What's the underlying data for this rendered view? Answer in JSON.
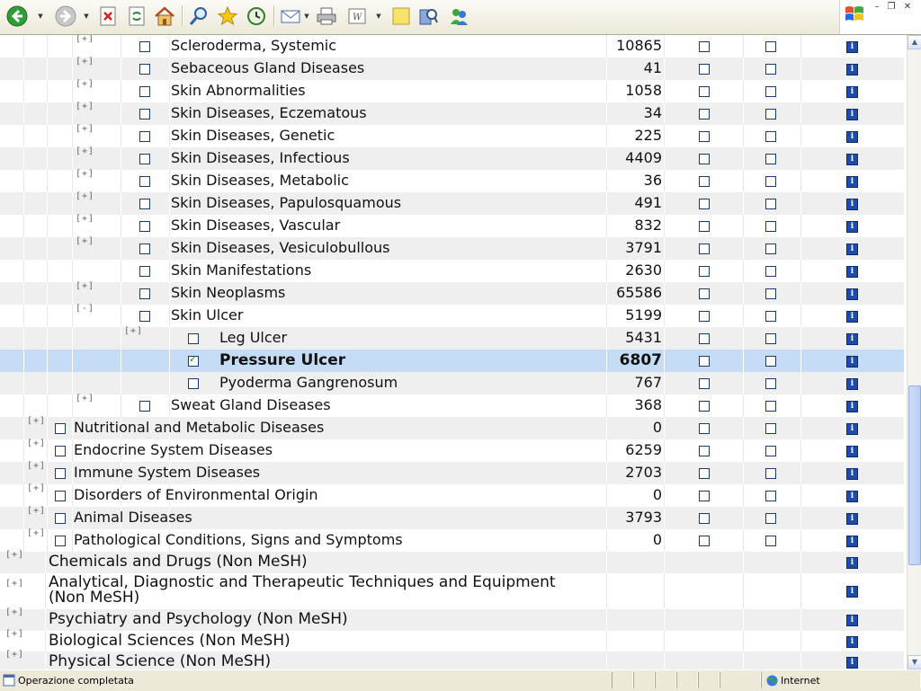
{
  "toolbar": {
    "buttons": [
      {
        "name": "back-button",
        "icon": "back-arrow-icon"
      },
      {
        "name": "forward-button",
        "icon": "forward-arrow-icon"
      },
      {
        "name": "stop-button",
        "icon": "stop-icon"
      },
      {
        "name": "refresh-button",
        "icon": "refresh-icon"
      },
      {
        "name": "home-button",
        "icon": "home-icon"
      },
      {
        "name": "search-button",
        "icon": "search-icon"
      },
      {
        "name": "favorites-button",
        "icon": "star-icon"
      },
      {
        "name": "history-button",
        "icon": "history-icon"
      },
      {
        "name": "mail-button",
        "icon": "mail-icon"
      },
      {
        "name": "print-button",
        "icon": "printer-icon"
      },
      {
        "name": "edit-button",
        "icon": "word-icon"
      },
      {
        "name": "discuss-button",
        "icon": "note-icon"
      },
      {
        "name": "research-button",
        "icon": "research-icon"
      },
      {
        "name": "messenger-button",
        "icon": "messenger-icon"
      }
    ],
    "window_controls": {
      "minimize": "–",
      "restore": "❐",
      "close": "✕"
    }
  },
  "tree": {
    "rows": [
      {
        "expander": "[+]",
        "label": "Scleroderma, Systemic",
        "count": "10865",
        "checked": false
      },
      {
        "expander": "[+]",
        "label": "Sebaceous Gland Diseases",
        "count": "41",
        "checked": false
      },
      {
        "expander": "[+]",
        "label": "Skin Abnormalities",
        "count": "1058",
        "checked": false
      },
      {
        "expander": "[+]",
        "label": "Skin Diseases, Eczematous",
        "count": "34",
        "checked": false
      },
      {
        "expander": "[+]",
        "label": "Skin Diseases, Genetic",
        "count": "225",
        "checked": false
      },
      {
        "expander": "[+]",
        "label": "Skin Diseases, Infectious",
        "count": "4409",
        "checked": false
      },
      {
        "expander": "[+]",
        "label": "Skin Diseases, Metabolic",
        "count": "36",
        "checked": false
      },
      {
        "expander": "[+]",
        "label": "Skin Diseases, Papulosquamous",
        "count": "491",
        "checked": false
      },
      {
        "expander": "[+]",
        "label": "Skin Diseases, Vascular",
        "count": "832",
        "checked": false
      },
      {
        "expander": "[+]",
        "label": "Skin Diseases, Vesiculobullous",
        "count": "3791",
        "checked": false
      },
      {
        "expander": "",
        "label": "Skin Manifestations",
        "count": "2630",
        "checked": false
      },
      {
        "expander": "[+]",
        "label": "Skin Neoplasms",
        "count": "65586",
        "checked": false
      },
      {
        "expander": "[-]",
        "label": "Skin Ulcer",
        "count": "5199",
        "checked": false
      },
      {
        "expander": "[+]",
        "label": "Leg Ulcer",
        "count": "5431",
        "checked": false
      },
      {
        "expander": "",
        "label": "Pressure Ulcer",
        "count": "6807",
        "checked": true
      },
      {
        "expander": "",
        "label": "Pyoderma Gangrenosum",
        "count": "767",
        "checked": false
      },
      {
        "expander": "[+]",
        "label": "Sweat Gland Diseases",
        "count": "368",
        "checked": false
      },
      {
        "expander": "[+]",
        "label": "Nutritional and Metabolic Diseases",
        "count": "0",
        "checked": false
      },
      {
        "expander": "[+]",
        "label": "Endocrine System Diseases",
        "count": "6259",
        "checked": false
      },
      {
        "expander": "[+]",
        "label": "Immune System Diseases",
        "count": "2703",
        "checked": false
      },
      {
        "expander": "[+]",
        "label": "Disorders of Environmental Origin",
        "count": "0",
        "checked": false
      },
      {
        "expander": "[+]",
        "label": "Animal Diseases",
        "count": "3793",
        "checked": false
      },
      {
        "expander": "[+]",
        "label": "Pathological Conditions, Signs and Symptoms",
        "count": "0",
        "checked": false
      },
      {
        "expander": "[+]",
        "label": "Chemicals and Drugs (Non MeSH)"
      },
      {
        "expander": "[+]",
        "label": "Analytical, Diagnostic and Therapeutic Techniques and Equipment",
        "label2": "(Non MeSH)"
      },
      {
        "expander": "[+]",
        "label": "Psychiatry and Psychology (Non MeSH)"
      },
      {
        "expander": "[+]",
        "label": "Biological Sciences (Non MeSH)"
      },
      {
        "expander": "[+]",
        "label": "Physical Science (Non MeSH)"
      }
    ],
    "info_icon": "i"
  },
  "status": {
    "text": "Operazione completata",
    "zone": "Internet"
  }
}
